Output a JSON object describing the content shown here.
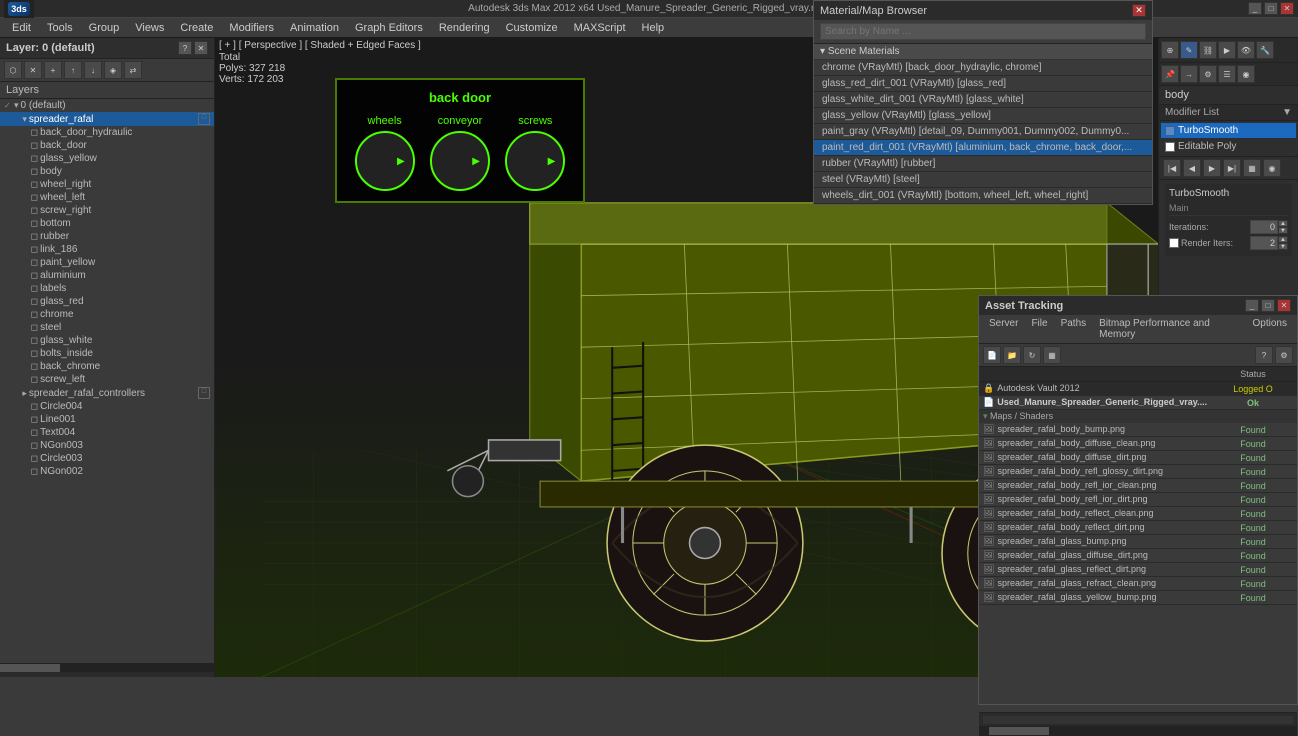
{
  "app": {
    "title": "Autodesk 3ds Max 2012 x64    Used_Manure_Spreader_Generic_Rigged_vray.max",
    "logo_text": "3ds"
  },
  "menu": {
    "items": [
      "Edit",
      "Tools",
      "Group",
      "Views",
      "Create",
      "Modifiers",
      "Animation",
      "Graph Editors",
      "Rendering",
      "Customize",
      "MAXScript",
      "Help"
    ]
  },
  "viewport": {
    "label": "[ + ] [ Perspective ] [ Shaded + Edged Faces ]",
    "stats_total": "Total",
    "stats_polys": "Polys: 327 218",
    "stats_verts": "Verts:  172 203"
  },
  "material_overlay": {
    "title": "back door",
    "groups": [
      {
        "label": "wheels"
      },
      {
        "label": "conveyor"
      },
      {
        "label": "screws"
      }
    ]
  },
  "layers": {
    "panel_title": "Layer: 0 (default)",
    "label": "Layers",
    "items": [
      {
        "id": "0_default",
        "name": "0 (default)",
        "level": 0,
        "type": "layer",
        "checked": true
      },
      {
        "id": "spreader_rafal",
        "name": "spreader_rafal",
        "level": 1,
        "type": "layer",
        "selected": true
      },
      {
        "id": "back_door_hydraulic",
        "name": "back_door_hydraulic",
        "level": 2,
        "type": "object"
      },
      {
        "id": "back_door",
        "name": "back_door",
        "level": 2,
        "type": "object"
      },
      {
        "id": "glass_yellow",
        "name": "glass_yellow",
        "level": 2,
        "type": "object"
      },
      {
        "id": "body",
        "name": "body",
        "level": 2,
        "type": "object"
      },
      {
        "id": "wheel_right",
        "name": "wheel_right",
        "level": 2,
        "type": "object"
      },
      {
        "id": "wheel_left",
        "name": "wheel_left",
        "level": 2,
        "type": "object"
      },
      {
        "id": "screw_right",
        "name": "screw_right",
        "level": 2,
        "type": "object"
      },
      {
        "id": "bottom",
        "name": "bottom",
        "level": 2,
        "type": "object"
      },
      {
        "id": "rubber",
        "name": "rubber",
        "level": 2,
        "type": "object"
      },
      {
        "id": "link_186",
        "name": "link_186",
        "level": 2,
        "type": "object"
      },
      {
        "id": "paint_yellow",
        "name": "paint_yellow",
        "level": 2,
        "type": "object"
      },
      {
        "id": "aluminium",
        "name": "aluminium",
        "level": 2,
        "type": "object"
      },
      {
        "id": "labels",
        "name": "labels",
        "level": 2,
        "type": "object"
      },
      {
        "id": "glass_red",
        "name": "glass_red",
        "level": 2,
        "type": "object"
      },
      {
        "id": "chrome",
        "name": "chrome",
        "level": 2,
        "type": "object"
      },
      {
        "id": "steel",
        "name": "steel",
        "level": 2,
        "type": "object"
      },
      {
        "id": "glass_white",
        "name": "glass_white",
        "level": 2,
        "type": "object"
      },
      {
        "id": "bolts_inside",
        "name": "bolts_inside",
        "level": 2,
        "type": "object"
      },
      {
        "id": "back_chrome",
        "name": "back_chrome",
        "level": 2,
        "type": "object"
      },
      {
        "id": "screw_left",
        "name": "screw_left",
        "level": 2,
        "type": "object"
      },
      {
        "id": "spreader_rafal_controllers",
        "name": "spreader_rafal_controllers",
        "level": 1,
        "type": "layer"
      },
      {
        "id": "Circle004",
        "name": "Circle004",
        "level": 2,
        "type": "object"
      },
      {
        "id": "Line001",
        "name": "Line001",
        "level": 2,
        "type": "object"
      },
      {
        "id": "Text004",
        "name": "Text004",
        "level": 2,
        "type": "object"
      },
      {
        "id": "NGon003",
        "name": "NGon003",
        "level": 2,
        "type": "object"
      },
      {
        "id": "Circle003",
        "name": "Circle003",
        "level": 2,
        "type": "object"
      },
      {
        "id": "NGon002",
        "name": "NGon002",
        "level": 2,
        "type": "object"
      }
    ]
  },
  "material_browser": {
    "title": "Material/Map Browser",
    "search_placeholder": "Search by Name ...",
    "section_header": "Scene Materials",
    "materials": [
      {
        "name": "chrome (VRayMtl) [back_door_hydraylic, chrome]"
      },
      {
        "name": "glass_red_dirt_001 (VRayMtl) [glass_red]"
      },
      {
        "name": "glass_white_dirt_001 (VRayMtl) [glass_white]"
      },
      {
        "name": "glass_yellow (VRayMtl) [glass_yellow]"
      },
      {
        "name": "paint_gray (VRayMtl) [detail_09, Dummy001, Dummy002, Dummy0..."
      },
      {
        "name": "paint_red_dirt_001 (VRayMtl) [aluminium, back_chrome, back_door,...",
        "selected": true
      },
      {
        "name": "rubber (VRayMtl) [rubber]"
      },
      {
        "name": "steel (VRayMtl) [steel]"
      },
      {
        "name": "wheels_dirt_001 (VRayMtl) [bottom, wheel_left, wheel_right]"
      }
    ]
  },
  "modifier_panel": {
    "object_name": "body",
    "modifier_list_label": "Modifier List",
    "modifiers": [
      {
        "name": "TurboSmooth",
        "active": true
      },
      {
        "name": "Editable Poly",
        "active": false
      }
    ],
    "turbosmooth": {
      "label": "TurboSmooth",
      "main_label": "Main",
      "iterations_label": "Iterations:",
      "iterations_value": "0",
      "render_iters_label": "Render Iters:",
      "render_iters_value": "2",
      "render_iters_checked": true
    }
  },
  "asset_tracking": {
    "title": "Asset Tracking",
    "menu_items": [
      "Server",
      "File",
      "Paths",
      "Bitmap Performance and Memory",
      "Options"
    ],
    "table_header": {
      "name": "",
      "status": "Status"
    },
    "rows": [
      {
        "name": "Autodesk Vault 2012",
        "status": "Logged O",
        "type": "vault"
      },
      {
        "name": "Used_Manure_Spreader_Generic_Rigged_vray....",
        "status": "Ok",
        "type": "file"
      },
      {
        "name": "Maps / Shaders",
        "status": "",
        "type": "section"
      },
      {
        "name": "spreader_rafal_body_bump.png",
        "status": "Found",
        "type": "asset"
      },
      {
        "name": "spreader_rafal_body_diffuse_clean.png",
        "status": "Found",
        "type": "asset"
      },
      {
        "name": "spreader_rafal_body_diffuse_dirt.png",
        "status": "Found",
        "type": "asset"
      },
      {
        "name": "spreader_rafal_body_refl_glossy_dirt.png",
        "status": "Found",
        "type": "asset"
      },
      {
        "name": "spreader_rafal_body_refl_ior_clean.png",
        "status": "Found",
        "type": "asset"
      },
      {
        "name": "spreader_rafal_body_refl_ior_dirt.png",
        "status": "Found",
        "type": "asset"
      },
      {
        "name": "spreader_rafal_body_reflect_clean.png",
        "status": "Found",
        "type": "asset"
      },
      {
        "name": "spreader_rafal_body_reflect_dirt.png",
        "status": "Found",
        "type": "asset"
      },
      {
        "name": "spreader_rafal_glass_bump.png",
        "status": "Found",
        "type": "asset"
      },
      {
        "name": "spreader_rafal_glass_diffuse_dirt.png",
        "status": "Found",
        "type": "asset"
      },
      {
        "name": "spreader_rafal_glass_reflect_dirt.png",
        "status": "Found",
        "type": "asset"
      },
      {
        "name": "spreader_rafal_glass_refract_clean.png",
        "status": "Found",
        "type": "asset"
      },
      {
        "name": "spreader_rafal_glass_yellow_bump.png",
        "status": "Found",
        "type": "asset"
      }
    ]
  }
}
